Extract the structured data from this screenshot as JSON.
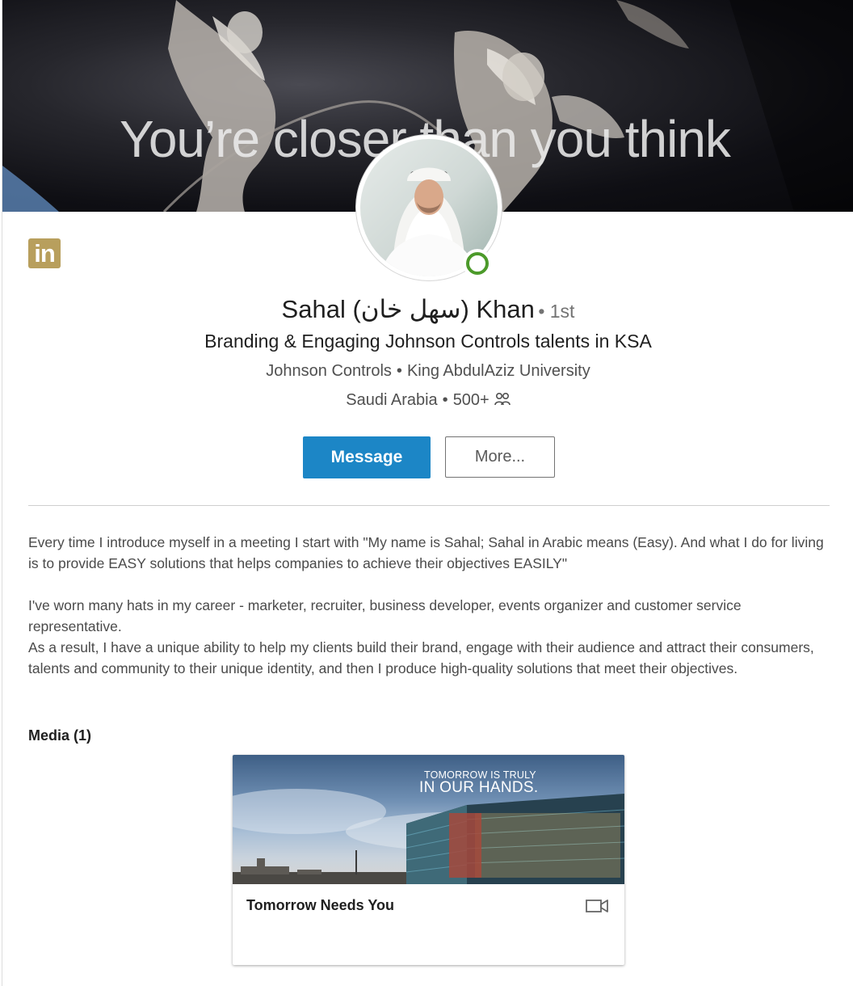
{
  "banner": {
    "tagline": "You’re closer than you think"
  },
  "logo": {
    "text": "in"
  },
  "profile": {
    "name": "Sahal (سهل خان) Khan",
    "degree": "• 1st",
    "headline": "Branding & Engaging Johnson Controls talents in KSA",
    "company": "Johnson Controls",
    "school": "King AbdulAziz University",
    "location": "Saudi Arabia",
    "connections": "500+",
    "online_status_color": "#4c9a2a"
  },
  "actions": {
    "message_label": "Message",
    "more_label": "More..."
  },
  "summary": {
    "paragraph1": "Every time I introduce myself in a meeting I start with \"My name is Sahal; Sahal in Arabic means (Easy). And what I do for living is to provide EASY solutions that helps companies to achieve their objectives EASILY\"",
    "paragraph2": "I've worn many hats in my career - marketer, recruiter, business developer, events organizer and customer service representative.",
    "paragraph3": "As a result, I have a unique ability to help my clients build their brand, engage with their audience and attract their consumers, talents and community to their unique identity, and then I produce high-quality solutions that meet their objectives."
  },
  "media": {
    "title": "Media (1)",
    "items": [
      {
        "thumb_small_text": "TOMORROW IS TRULY",
        "thumb_big_text": "IN OUR HANDS.",
        "caption": "Tomorrow Needs You",
        "type_icon": "video-camera-icon"
      }
    ]
  },
  "colors": {
    "primary_button": "#1c86c6",
    "logo_gold": "#b89f5d"
  }
}
